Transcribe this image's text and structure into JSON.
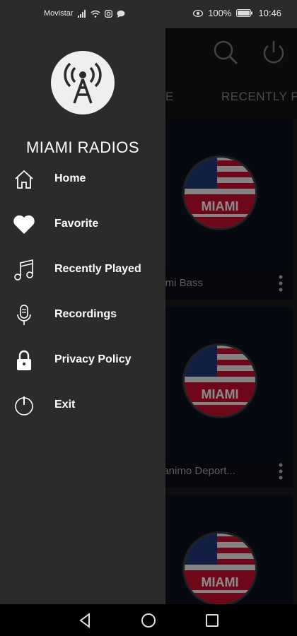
{
  "status_bar": {
    "carrier": "Movistar",
    "battery": "100%",
    "time": "10:46",
    "icons": [
      "signal-icon",
      "wifi-icon",
      "instagram-icon",
      "chat-icon",
      "eye-icon",
      "battery-icon"
    ]
  },
  "app": {
    "toolbar_icons": [
      "search-icon",
      "power-icon"
    ],
    "tabs": [
      {
        "label": "E"
      },
      {
        "label": "RECENTLY PL"
      }
    ],
    "stations": [
      {
        "name": "iami Bass",
        "logo_text": "MIAMI"
      },
      {
        "name": "nanimo Deport...",
        "logo_text": "MIAMI"
      },
      {
        "name": "",
        "logo_text": "MIAMI"
      }
    ]
  },
  "drawer": {
    "title": "MIAMI RADIOS",
    "logo_icon": "radio-tower-icon",
    "items": [
      {
        "label": "Home",
        "icon": "home-icon"
      },
      {
        "label": "Favorite",
        "icon": "heart-icon"
      },
      {
        "label": "Recently Played",
        "icon": "music-note-icon"
      },
      {
        "label": "Recordings",
        "icon": "microphone-icon"
      },
      {
        "label": "Privacy Policy",
        "icon": "lock-icon"
      },
      {
        "label": "Exit",
        "icon": "power-icon"
      }
    ]
  },
  "nav_bar": {
    "buttons": [
      "back-icon",
      "home-circle-icon",
      "recents-square-icon"
    ]
  },
  "colors": {
    "drawer_bg": "#2b2b2b",
    "app_bg": "#141414",
    "flag_red": "#c8102e",
    "flag_blue": "#1f3a7a"
  }
}
